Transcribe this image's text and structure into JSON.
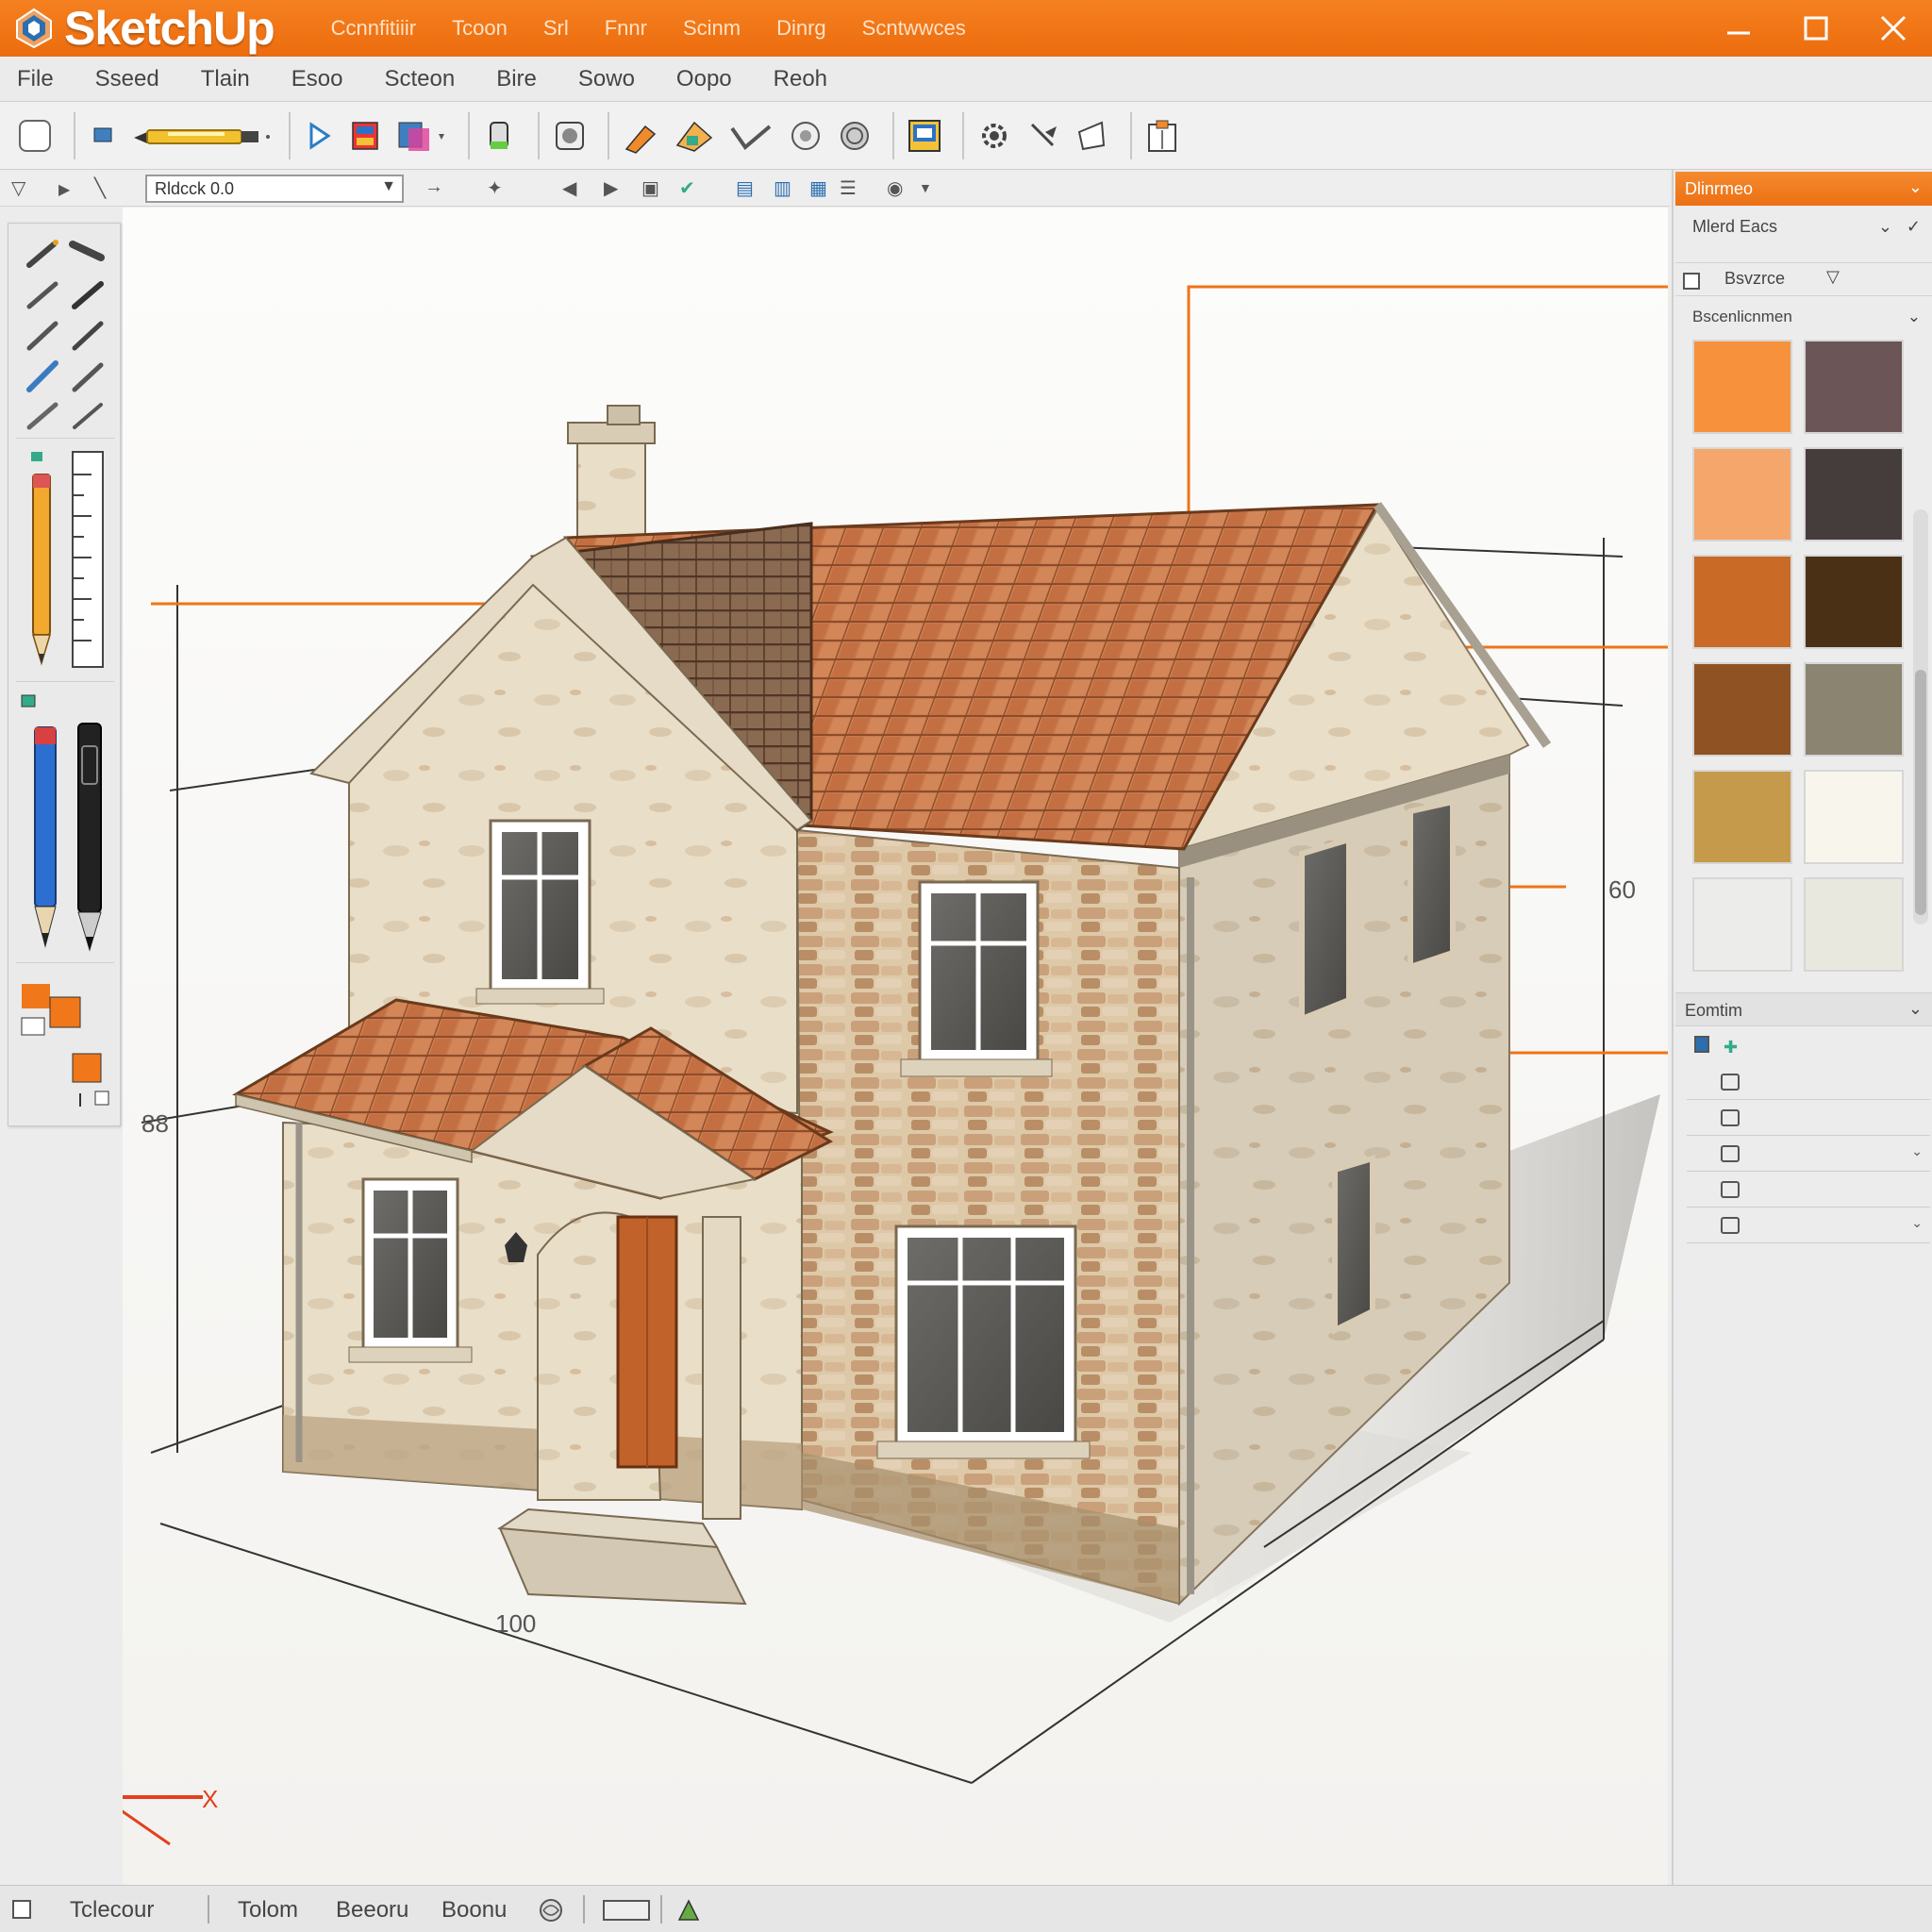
{
  "app": {
    "name": "SketchUp"
  },
  "title_menu": [
    "Ccnnfitiiir",
    "Tcoon",
    "Srl",
    "Fnnr",
    "Scinm",
    "Dinrg",
    "Scntwwces"
  ],
  "menu": [
    "File",
    "Sseed",
    "Tlain",
    "Esoo",
    "Scteon",
    "Bire",
    "Sowo",
    "Oopo",
    "Reoh"
  ],
  "layer_select": {
    "value": "Rldcck 0.0"
  },
  "materials_panel": {
    "title": "Dlinrmeo",
    "tabs_label": "Mlerd Eacs",
    "browse_label": "Bsvzrce",
    "category_label": "Bscenlicnmen",
    "swatches": [
      "#f7913c",
      "#6c5556",
      "#f4a66b",
      "#453d3c",
      "#c96a27",
      "#4a3115",
      "#8f5223",
      "#8a8470",
      "#c59a4a",
      "#f8f6ec",
      "#ececeb",
      "#e8e8de"
    ]
  },
  "components_panel": {
    "title": "Eomtim",
    "rows": 5
  },
  "dimensions": {
    "left_height": "88",
    "right_height": "60",
    "front_length": "100"
  },
  "axes": {
    "x_label": "X",
    "x_label_2": "X"
  },
  "statusbar": {
    "item1": "Tclecour",
    "item2": "Tolom",
    "item3": "Beeoru",
    "item4": "Boonu"
  },
  "colors": {
    "accent": "#ef7417",
    "axis_red": "#e2401e",
    "axis_green": "#5fb424",
    "axis_blue": "#2b4fc8"
  }
}
